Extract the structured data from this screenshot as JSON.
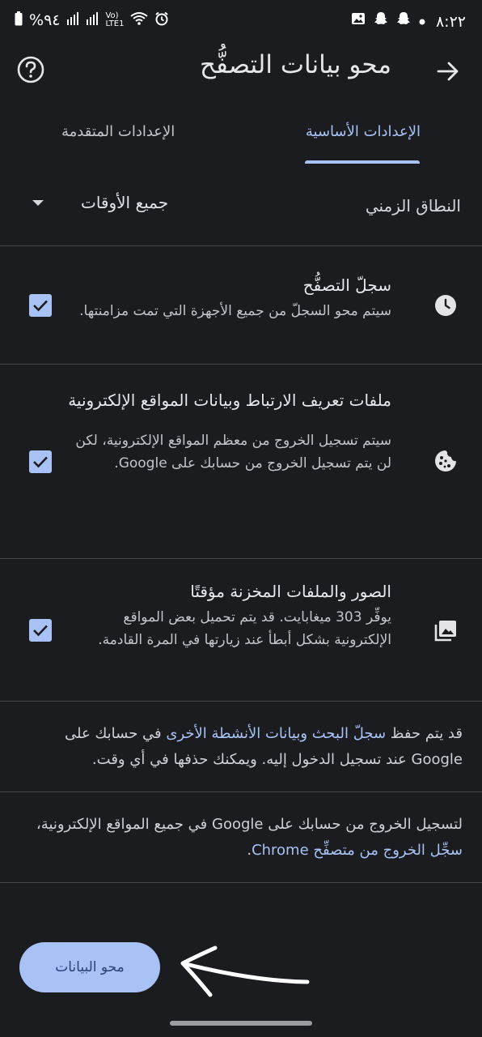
{
  "status_bar": {
    "time": "٨:٢٢",
    "battery": "%٩٤",
    "network_top": "Vo)",
    "network_bottom": "LTE1",
    "notification_icons": [
      "dot-icon",
      "snapchat-icon",
      "snapchat-icon",
      "image-icon"
    ]
  },
  "app_bar": {
    "title": "محو بيانات التصفُّح"
  },
  "tabs": {
    "basic": "الإعدادات الأساسية",
    "advanced": "الإعدادات المتقدمة"
  },
  "time_range": {
    "label": "النطاق الزمني",
    "value": "جميع الأوقات"
  },
  "items": [
    {
      "title": "سجلّ التصفُّح",
      "description": "سيتم محو السجلّ من جميع الأجهزة التي تمت مزامنتها.",
      "icon": "clock-icon",
      "checked": true
    },
    {
      "title": "ملفات تعريف الارتباط وبيانات المواقع الإلكترونية",
      "description": "سيتم تسجيل الخروج من معظم المواقع الإلكترونية، لكن لن يتم تسجيل الخروج من حسابك على Google.",
      "icon": "cookie-icon",
      "checked": true
    },
    {
      "title": "الصور والملفات المخزنة مؤقتًا",
      "description": "يوفِّر 303 ميغابايت. قد يتم تحميل بعض المواقع الإلكترونية بشكل أبطأ عند زيارتها في المرة القادمة.",
      "icon": "images-icon",
      "checked": true
    }
  ],
  "info1": {
    "prefix": "قد يتم حفظ ",
    "link": "سجلّ البحث وبيانات الأنشطة الأخرى",
    "suffix": " في حسابك على Google عند تسجيل الدخول إليه. ويمكنك حذفها في أي وقت."
  },
  "info2": {
    "prefix": "لتسجيل الخروج من حسابك على Google في جميع المواقع الإلكترونية، ",
    "link": "سجِّل الخروج من متصفِّح Chrome",
    "suffix": "."
  },
  "clear_button": {
    "label": "محو البيانات"
  },
  "colors": {
    "accent": "#a8c2f5",
    "background": "#1b1c20",
    "divider": "#46474d"
  }
}
